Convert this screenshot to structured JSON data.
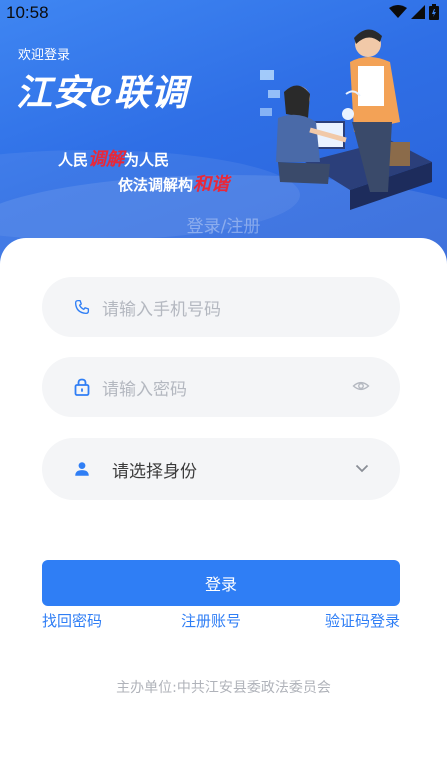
{
  "status_bar": {
    "time": "10:58"
  },
  "banner": {
    "welcome": "欢迎登录",
    "app_title": "江安e联调",
    "slogan_line1_a": "人民",
    "slogan_line1_red": "调解",
    "slogan_line1_b": "为人民",
    "slogan_line2_a": "依法调解构",
    "slogan_line2_red": "和谐",
    "tabs_text": "登录/注册"
  },
  "form": {
    "phone_placeholder": "请输入手机号码",
    "password_placeholder": "请输入密码",
    "identity_label": "请选择身份",
    "login_label": "登录"
  },
  "links": {
    "forgot": "找回密码",
    "register": "注册账号",
    "sms_login": "验证码登录"
  },
  "footer": {
    "sponsor": "主办单位:中共江安县委政法委员会"
  },
  "colors": {
    "primary": "#2f7ef5",
    "banner": "#3f86f2",
    "field_bg": "#f4f5f7",
    "placeholder": "#b4b8c0"
  },
  "icons": [
    "phone-icon",
    "lock-icon",
    "eye-icon",
    "user-icon",
    "chevron-down-icon",
    "wifi-icon",
    "signal-icon",
    "battery-icon"
  ]
}
